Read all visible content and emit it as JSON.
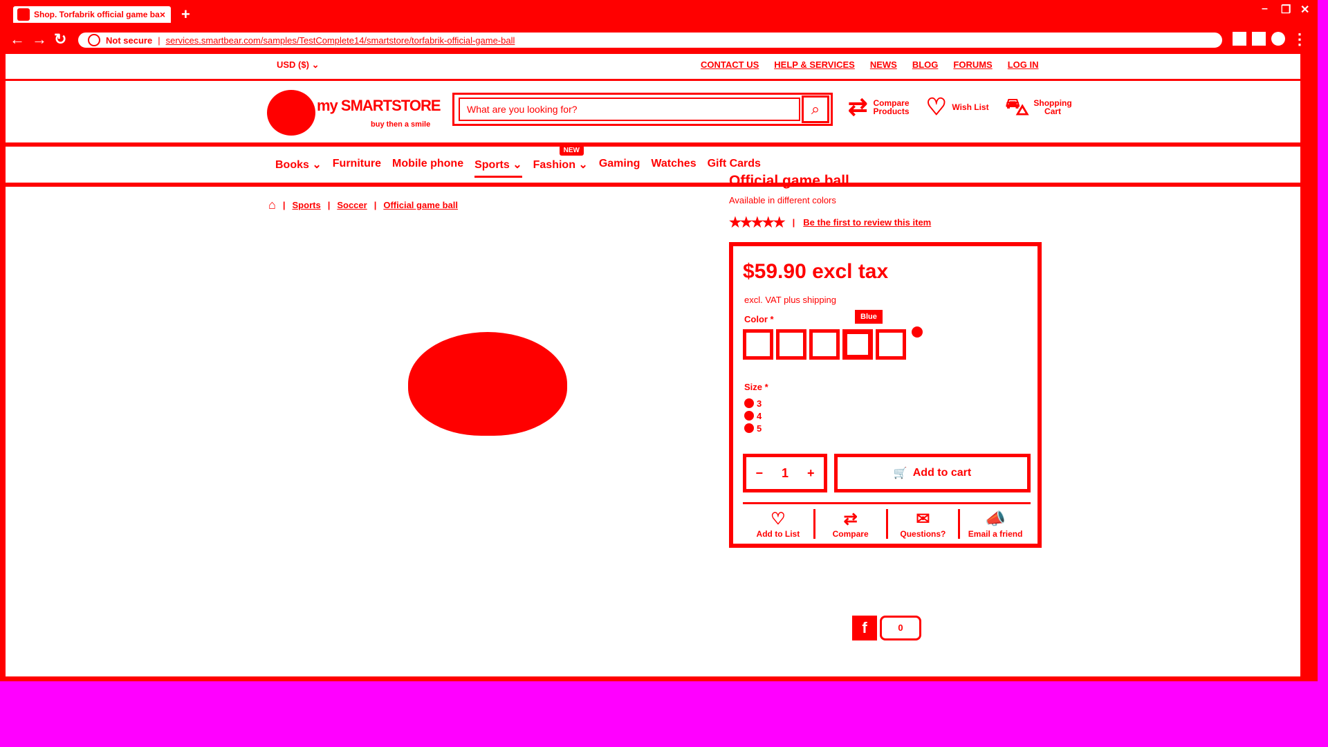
{
  "browser": {
    "tab_title": "Shop. Torfabrik official game ball",
    "tab_close": "×",
    "new_tab": "+",
    "not_secure": "Not secure",
    "url": "services.smartbear.com/samples/TestComplete14/smartstore/torfabrik-official-game-ball"
  },
  "topbar": {
    "currency": "USD ($)",
    "links": [
      "CONTACT US",
      "HELP & SERVICES",
      "NEWS",
      "BLOG",
      "FORUMS",
      "LOG IN"
    ]
  },
  "header": {
    "logo_name": "my SMARTSTORE",
    "logo_tagline": "buy then a smile",
    "search_placeholder": "What are you looking for?",
    "compare_label": "Compare Products",
    "wishlist_label": "Wish List",
    "cart_label": "Shopping Cart"
  },
  "menu": {
    "items": [
      "Books",
      "Furniture",
      "Mobile phone",
      "Sports",
      "Fashion",
      "Gaming",
      "Watches",
      "Gift Cards"
    ],
    "fashion_badge": "NEW"
  },
  "breadcrumb": {
    "items": [
      "Sports",
      "Soccer",
      "Official game ball"
    ]
  },
  "product": {
    "title": "Official game ball",
    "subtitle": "Available in different colors",
    "stars": "★★★★★",
    "review_link": "Be the first to review this item",
    "price": "$59.90 excl tax",
    "vat_note": "excl. VAT plus shipping",
    "color_label": "Color *",
    "color_tooltip": "Blue",
    "size_label": "Size *",
    "sizes": [
      "3",
      "4",
      "5"
    ],
    "qty_minus": "−",
    "qty_value": "1",
    "qty_plus": "+",
    "add_to_cart": "Add to cart",
    "actions": [
      "Add to List",
      "Compare",
      "Questions?",
      "Email a friend"
    ],
    "share_count": "0"
  },
  "colors": {
    "accent": "#ff0000",
    "background": "#ff00ff"
  }
}
